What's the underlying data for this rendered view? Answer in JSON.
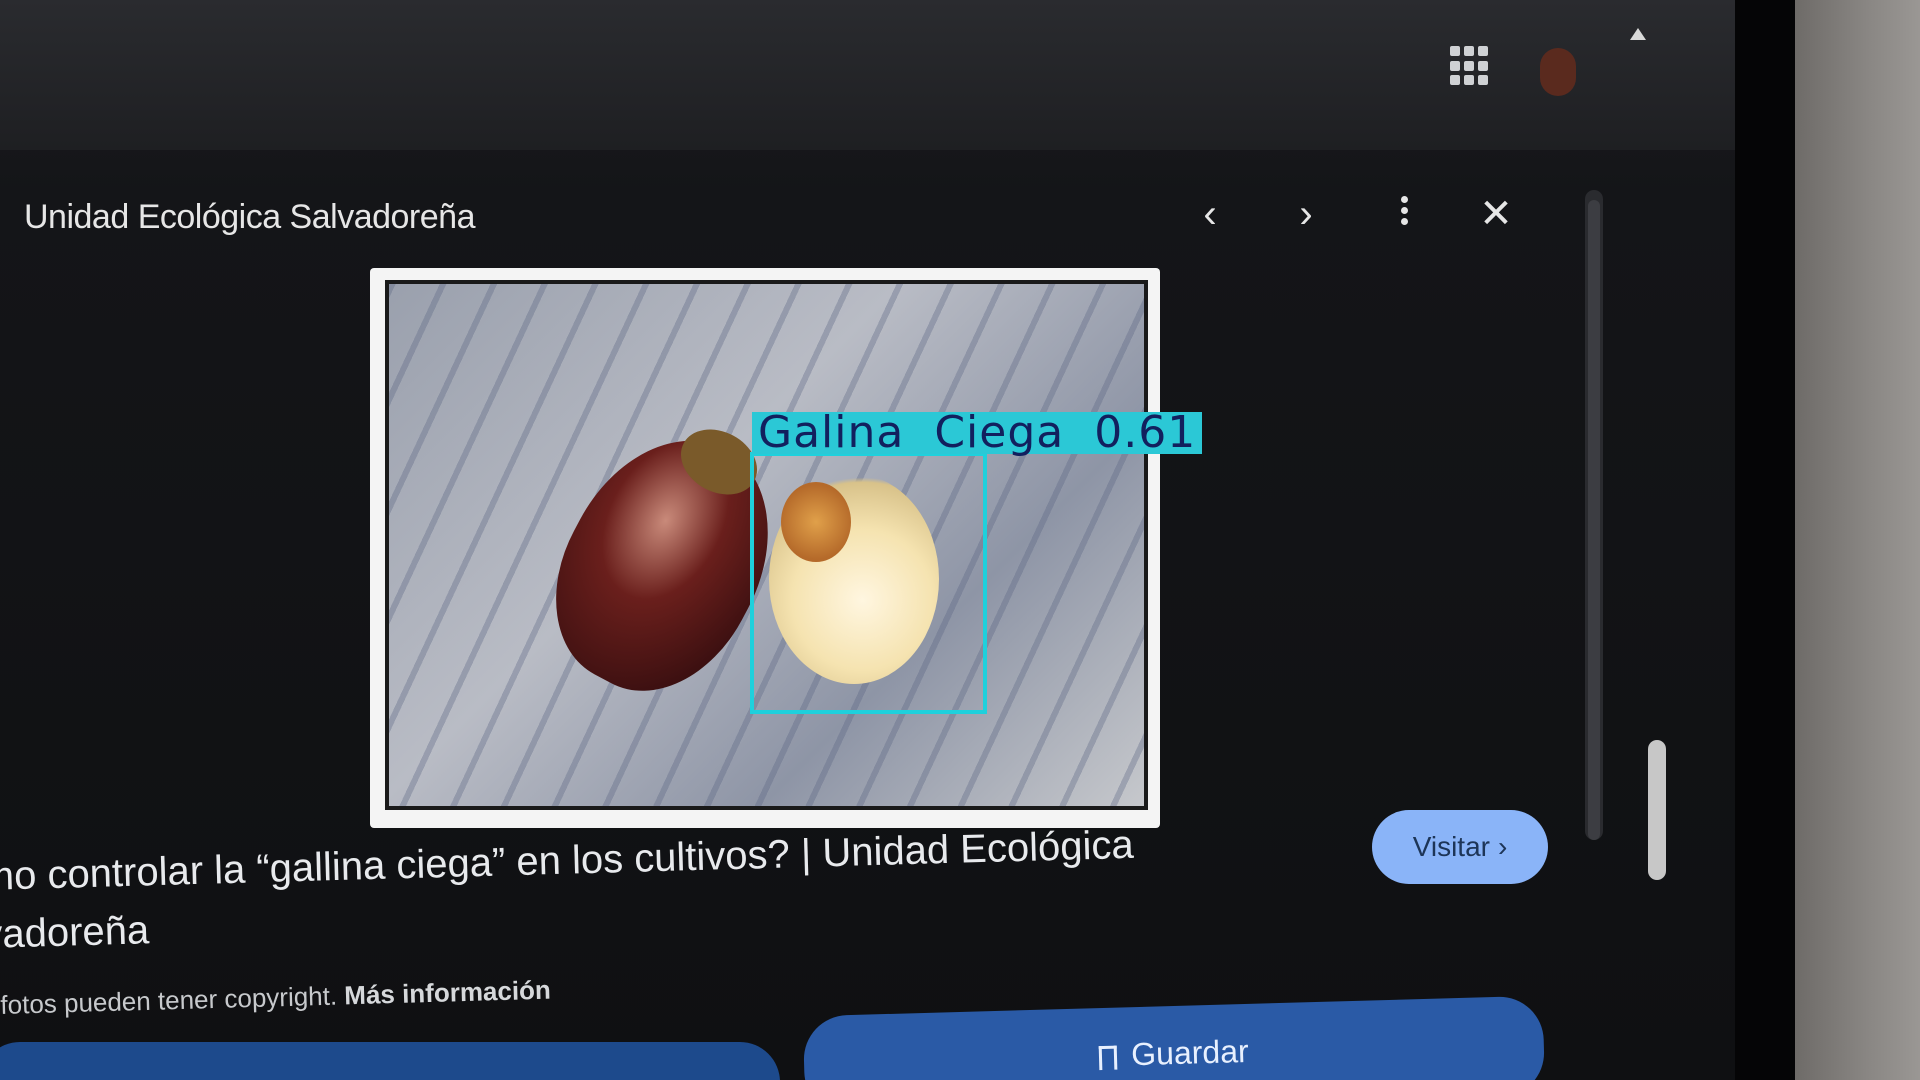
{
  "header": {
    "source_title": "Unidad Ecológica Salvadoreña",
    "prev_icon": "chevron-left-icon",
    "next_icon": "chevron-right-icon",
    "more_icon": "more-vert-icon",
    "close_icon": "close-icon",
    "apps_icon": "apps-grid-icon"
  },
  "preview": {
    "detection_label": "Galina  Ciega  0.61",
    "detection_color": "#1fd0dc"
  },
  "caption": {
    "title_line1": "mo controlar la “gallina ciega” en los cultivos? | Unidad Ecológica",
    "title_line2": "vadoreña",
    "copyright_text": "fotos pueden tener copyright.",
    "copyright_link": "Más información"
  },
  "actions": {
    "visit_label": "Visitar",
    "visit_chevron": "›",
    "save_label": "Guardar"
  },
  "colors": {
    "accent": "#8ab4f8",
    "save_button": "#2a5aa6"
  }
}
